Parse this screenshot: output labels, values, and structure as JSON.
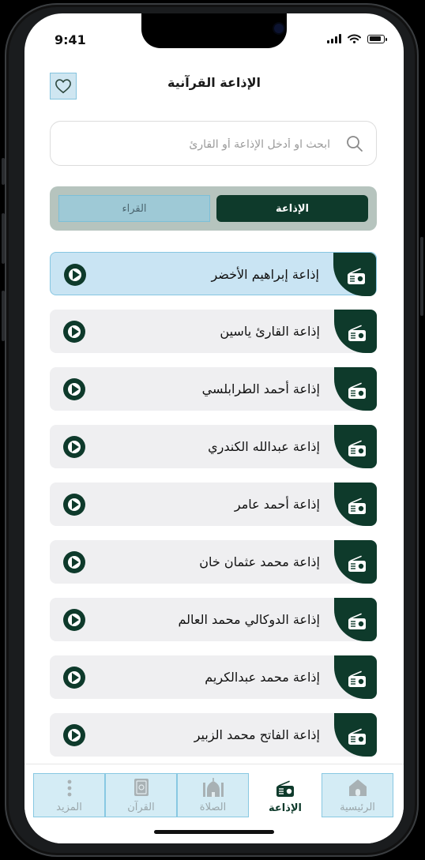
{
  "status_bar": {
    "time": "9:41"
  },
  "header": {
    "title": "الإذاعة القرآنية",
    "favorite_icon": "heart-icon"
  },
  "search": {
    "placeholder": "ابحث او أدخل الإذاعة أو القارئ",
    "icon": "search-icon"
  },
  "segment": {
    "active_label": "الإذاعة",
    "inactive_label": "القراء"
  },
  "stations": [
    {
      "name": "إذاعة إبراهيم الأخضر"
    },
    {
      "name": "إذاعة القارئ ياسين"
    },
    {
      "name": "إذاعة أحمد الطرابلسي"
    },
    {
      "name": "إذاعة عبدالله الكندري"
    },
    {
      "name": "إذاعة أحمد عامر"
    },
    {
      "name": "إذاعة محمد عثمان خان"
    },
    {
      "name": "إذاعة الدوكالي محمد العالم"
    },
    {
      "name": "إذاعة محمد عبدالكريم"
    },
    {
      "name": "إذاعة الفاتح محمد الزبير"
    }
  ],
  "tabbar": {
    "home": "الرئيسية",
    "radio": "الإذاعة",
    "prayer": "الصلاة",
    "quran": "القرآن",
    "more": "المزيد"
  },
  "colors": {
    "primary": "#0e3a2b",
    "segment_bg": "#b6c4be",
    "highlight": "#c9e4f3"
  }
}
